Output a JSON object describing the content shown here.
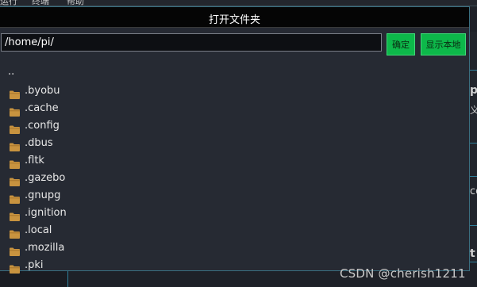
{
  "background": {
    "menu_items": [
      "运行",
      "终端",
      "帮助"
    ],
    "side_glyphs": [
      "p",
      "义",
      "co",
      "t"
    ]
  },
  "dialog": {
    "title": "打开文件夹",
    "path_value": "/home/pi/",
    "confirm_label": "确定",
    "show_local_label": "显示本地",
    "parent_entry": "..",
    "entries": [
      ".byobu",
      ".cache",
      ".config",
      ".dbus",
      ".fltk",
      ".gazebo",
      ".gnupg",
      ".ignition",
      ".local",
      ".mozilla",
      ".pki"
    ],
    "folder_icon": "folder-icon",
    "colors": {
      "accent_button": "#0db84a",
      "folder": "#c8933f",
      "titlebar": "#050505"
    }
  },
  "watermark": "CSDN @cherish1211"
}
